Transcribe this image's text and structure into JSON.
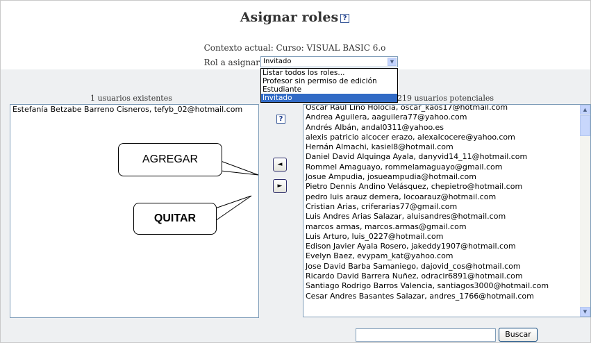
{
  "page": {
    "title": "Asignar roles",
    "help_glyph": "?",
    "context_text": "Contexto actual: Curso: VISUAL BASIC 6.o",
    "role_label": "Rol a asignar",
    "role_selected": "Invitado",
    "role_options": [
      "Listar todos los roles...",
      "Profesor sin permiso de edición",
      "Estudiante",
      "Invitado"
    ]
  },
  "existing": {
    "header": "1 usuarios existentes",
    "users": [
      "Estefanía Betzabe Barreno Cisneros, tefyb_02@hotmail.com"
    ]
  },
  "potential": {
    "header": "219 usuarios potenciales",
    "users": [
      "Oscar Raúl Lino Holocia, oscar_kaos17@hotmail.com",
      "Andrea Aguilera, aaguilera77@yahoo.com",
      "Andrés Albán, andal0311@yahoo.es",
      "alexis patricio alcocer erazo, alexalcocere@yahoo.com",
      "Hernán Almachi, kasiel8@hotmail.com",
      "Daniel David Alquinga Ayala, danyvid14_11@hotmail.com",
      "Rommel Amaguayo, rommelamaguayo@gmail.com",
      "Josue Ampudia, josueampudia@hotmail.com",
      "Pietro Dennis Andino Velásquez, chepietro@hotmail.com",
      "pedro luis arauz demera, locoarauz@hotmail.com",
      "Cristian Arias, criferarias77@gmail.com",
      "Luis Andres Arias Salazar, aluisandres@hotmail.com",
      "marcos armas, marcos.armas@gmail.com",
      "Luis Arturo, luis_0227@hotmail.com",
      "Edison Javier Ayala Rosero, jakeddy1907@hotmail.com",
      "Evelyn Baez, evypam_kat@yahoo.com",
      "Jose David Barba Samaniego, dajovid_cos@hotmail.com",
      "Ricardo David Barrera Nuñez, odracir6891@hotmail.com",
      "Santiago Rodrigo Barros Valencia, santiagos3000@hotmail.com",
      "Cesar Andres Basantes Salazar, andres_1766@hotmail.com"
    ]
  },
  "controls": {
    "add_glyph": "◄",
    "remove_glyph": "►",
    "search_value": "",
    "search_button": "Buscar",
    "scroll_up_glyph": "▲",
    "scroll_down_glyph": "▼",
    "select_arrow_glyph": "▼"
  },
  "callouts": {
    "agregar": "AGREGAR",
    "quitar": "QUITAR"
  },
  "colors": {
    "selected_option_bg": "#316ac5",
    "body_bg": "#eef0f2"
  }
}
